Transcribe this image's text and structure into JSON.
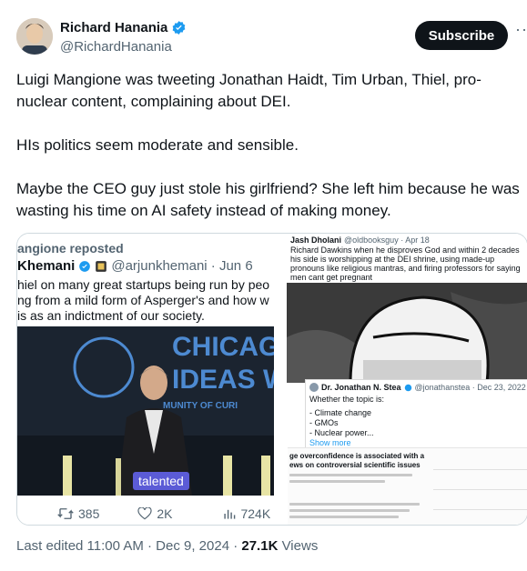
{
  "author": {
    "display_name": "Richard Hanania",
    "handle": "@RichardHanania",
    "verified_icon": "verified-badge-icon"
  },
  "actions": {
    "subscribe_label": "Subscribe",
    "more_label": "···"
  },
  "tweet": {
    "paragraphs": [
      "Luigi Mangione was tweeting Jonathan Haidt, Tim Urban, Thiel, pro-nuclear content, complaining about DEI.",
      "HIs politics seem moderate and sensible.",
      "Maybe the CEO guy just stole his girlfriend? She left him because he was wasting his time on AI safety instead of making money."
    ]
  },
  "media": {
    "left": {
      "repost_line": "angione reposted",
      "author_name": "Khemani",
      "author_handle": "@arjunkhemani · Jun 6",
      "text_lines": [
        "hiel on many great startups being run by peo",
        "ng from a mild form of Asperger's and how w",
        "is as an indictment of our society."
      ],
      "video_text": [
        "CHICAGO",
        "IDEAS W",
        "MUNITY OF CURI"
      ],
      "caption": "talented",
      "stats": {
        "replies": "385",
        "likes": "2K",
        "views": "724K"
      }
    },
    "right": {
      "top_author": "Jash Dholani",
      "top_handle": "@oldbooksguy · Apr 18",
      "top_text": "Richard Dawkins when he disproves God and within 2 decades his side is worshipping at the DEI shrine, using made-up pronouns like religious mantras, and firing professors for saying men cant get pregnant",
      "card_author": "Dr. Jonathan N. Stea",
      "card_handle": "@jonathanstea · Dec 23, 2022",
      "card_lines": [
        "Whether the topic is:",
        "- Climate change",
        "- GMOs",
        "- Nuclear power..."
      ],
      "show_more": "Show more",
      "paper_title": "ge overconfidence is associated with a ews on controversial scientific issues"
    }
  },
  "footer": {
    "edited": "Last edited 11:00 AM · Dec 9, 2024 · ",
    "views_count": "27.1K",
    "views_label": " Views"
  },
  "colors": {
    "accent": "#1d9bf0",
    "text": "#0f1419",
    "muted": "#536471",
    "subscribe_bg": "#0f1419",
    "caption_bg": "#5b5bd6"
  }
}
